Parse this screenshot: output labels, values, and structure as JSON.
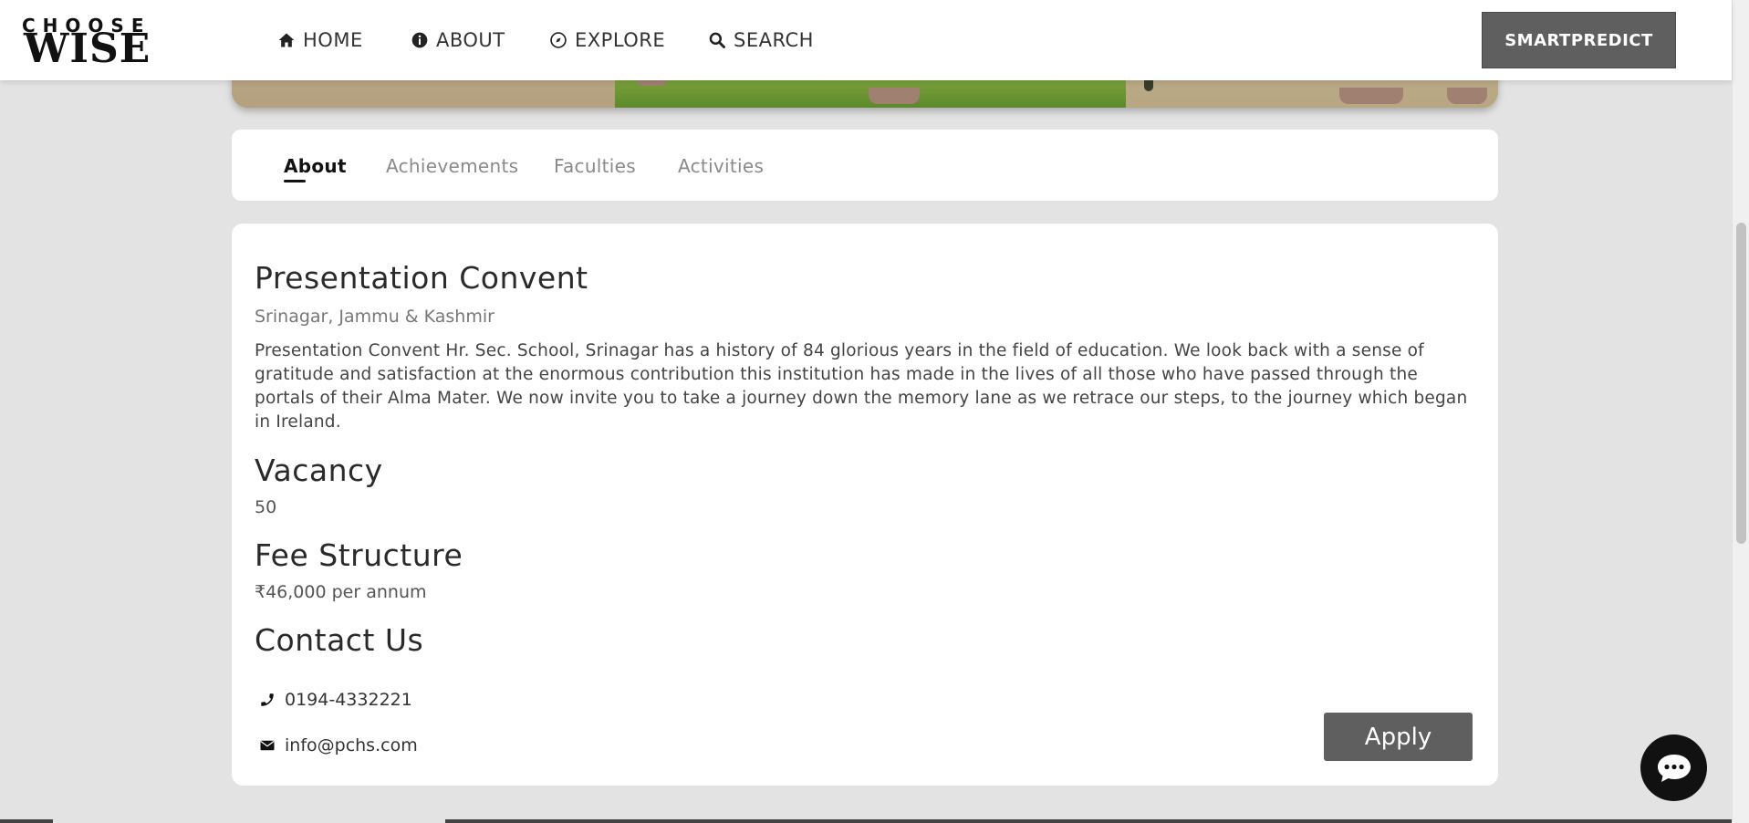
{
  "nav": {
    "logo_top": "CHOOSE",
    "logo_bottom": "WISE",
    "items": [
      {
        "label": "HOME",
        "icon": "home-icon"
      },
      {
        "label": "ABOUT",
        "icon": "info-icon"
      },
      {
        "label": "EXPLORE",
        "icon": "compass-icon"
      },
      {
        "label": "SEARCH",
        "icon": "search-icon"
      }
    ],
    "cta_label": "SMARTPREDICT"
  },
  "tabs": [
    {
      "label": "About",
      "active": true
    },
    {
      "label": "Achievements",
      "active": false
    },
    {
      "label": "Faculties",
      "active": false
    },
    {
      "label": "Activities",
      "active": false
    }
  ],
  "school": {
    "name": "Presentation Convent",
    "location": "Srinagar, Jammu & Kashmir",
    "description": "Presentation Convent Hr. Sec. School, Srinagar has a history of 84 glorious years in the field of education. We look back with a sense of gratitude and satisfaction at the enormous contribution this institution has made in the lives of all those who have passed through the portals of their Alma Mater. We now invite you to take a journey down the memory lane as we retrace our steps, to the journey which began in Ireland."
  },
  "vacancy": {
    "heading": "Vacancy",
    "value": "50"
  },
  "fees": {
    "heading": "Fee Structure",
    "value": "₹46,000 per annum"
  },
  "contact": {
    "heading": "Contact Us",
    "phone": "0194-4332221",
    "email": "info@pchs.com"
  },
  "apply_label": "Apply",
  "colors": {
    "button": "#5f5f5f",
    "background": "#e3e3e3",
    "chat": "#111111"
  }
}
